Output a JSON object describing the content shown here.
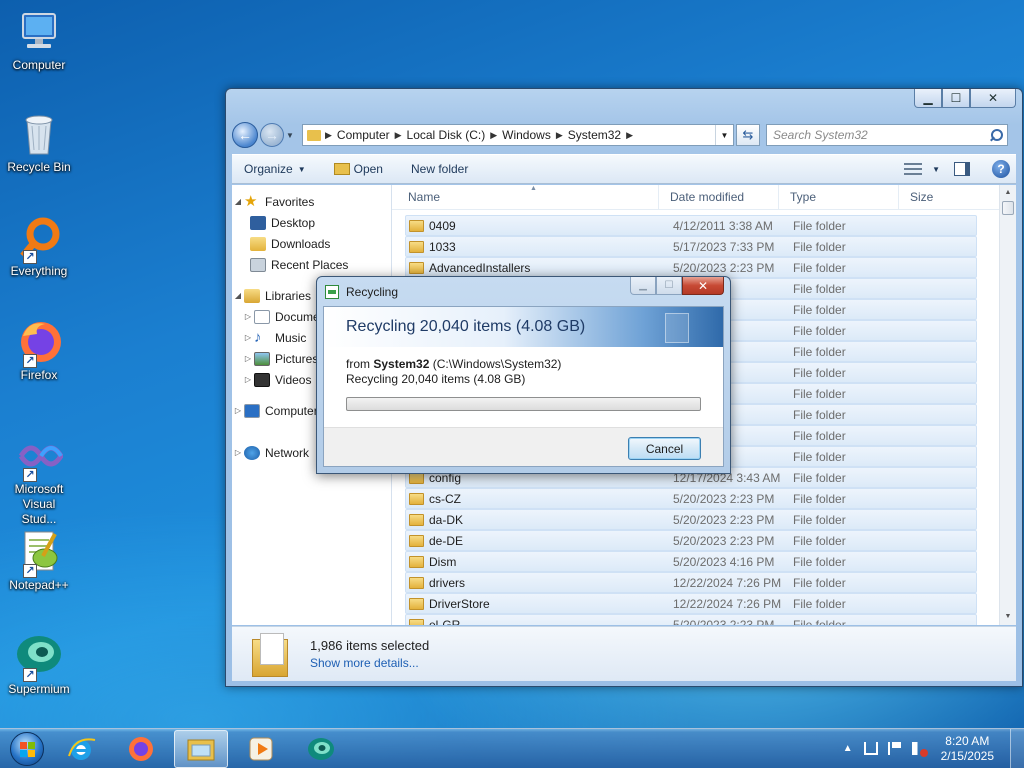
{
  "desktop": {
    "icons": [
      {
        "label": "Computer",
        "icon": "computer-icon"
      },
      {
        "label": "Recycle Bin",
        "icon": "recycle-bin-icon"
      },
      {
        "label": "Everything",
        "icon": "everything-search-icon"
      },
      {
        "label": "Firefox",
        "icon": "firefox-icon"
      },
      {
        "label": "Microsoft Visual Stud...",
        "icon": "visual-studio-icon"
      },
      {
        "label": "Notepad++",
        "icon": "notepad-plus-plus-icon"
      },
      {
        "label": "Supermium",
        "icon": "supermium-icon"
      }
    ]
  },
  "explorer": {
    "controls": {
      "minimize": "▁",
      "maximize": "☐",
      "close": "✕"
    },
    "address": {
      "crumbs": [
        "Computer",
        "Local Disk (C:)",
        "Windows",
        "System32"
      ],
      "sep": "▶"
    },
    "search_placeholder": "Search System32",
    "toolbar": {
      "organize": "Organize",
      "open": "Open",
      "new_folder": "New folder"
    },
    "navpane": {
      "favorites": "Favorites",
      "desktop": "Desktop",
      "downloads": "Downloads",
      "recent_places": "Recent Places",
      "libraries": "Libraries",
      "documents": "Documents",
      "music": "Music",
      "pictures": "Pictures",
      "videos": "Videos",
      "computer": "Computer",
      "network": "Network"
    },
    "columns": {
      "name": "Name",
      "date": "Date modified",
      "type": "Type",
      "size": "Size"
    },
    "rows": [
      {
        "name": "0409",
        "date": "4/12/2011 3:38 AM",
        "type": "File folder"
      },
      {
        "name": "1033",
        "date": "5/17/2023 7:33 PM",
        "type": "File folder"
      },
      {
        "name": "AdvancedInstallers",
        "date": "5/20/2023 2:23 PM",
        "type": "File folder"
      },
      {
        "name": "",
        "date": "37 PM",
        "type": "File folder"
      },
      {
        "name": "",
        "date": "17 PM",
        "type": "File folder"
      },
      {
        "name": "",
        "date": "20 PM",
        "type": "File folder"
      },
      {
        "name": "",
        "date": "20 PM",
        "type": "File folder"
      },
      {
        "name": "",
        "date": "03 AM",
        "type": "File folder"
      },
      {
        "name": "",
        "date": "30 AM",
        "type": "File folder"
      },
      {
        "name": "",
        "date": "03 AM",
        "type": "File folder"
      },
      {
        "name": "",
        "date": "38 AM",
        "type": "File folder"
      },
      {
        "name": "",
        "date": "43 AM",
        "type": "File folder"
      },
      {
        "name": "config",
        "date": "12/17/2024 3:43 AM",
        "type": "File folder"
      },
      {
        "name": "cs-CZ",
        "date": "5/20/2023 2:23 PM",
        "type": "File folder"
      },
      {
        "name": "da-DK",
        "date": "5/20/2023 2:23 PM",
        "type": "File folder"
      },
      {
        "name": "de-DE",
        "date": "5/20/2023 2:23 PM",
        "type": "File folder"
      },
      {
        "name": "Dism",
        "date": "5/20/2023 4:16 PM",
        "type": "File folder"
      },
      {
        "name": "drivers",
        "date": "12/22/2024 7:26 PM",
        "type": "File folder"
      },
      {
        "name": "DriverStore",
        "date": "12/22/2024 7:26 PM",
        "type": "File folder"
      },
      {
        "name": "el-GR",
        "date": "5/20/2023 2:23 PM",
        "type": "File folder"
      }
    ],
    "details": {
      "count": "1,986 items selected",
      "link": "Show more details..."
    }
  },
  "dialog": {
    "title": "Recycling",
    "controls": {
      "minimize": "▁",
      "maximize": "☐",
      "close": "✕"
    },
    "header": "Recycling 20,040 items (4.08 GB)",
    "from_prefix": "from ",
    "from_name": "System32",
    "from_path": " (C:\\Windows\\System32)",
    "status": "Recycling 20,040 items (4.08 GB)",
    "progress": 0.0,
    "cancel": "Cancel"
  },
  "taskbar": {
    "items": [
      "start-orb",
      "internet-explorer-icon",
      "firefox-icon",
      "windows-explorer-icon",
      "media-player-icon",
      "supermium-icon"
    ],
    "tray_caret": "▲",
    "time": "8:20 AM",
    "date": "2/15/2025"
  },
  "colors": {
    "accent": "#1b7fd0",
    "progress": "#37b01e"
  }
}
